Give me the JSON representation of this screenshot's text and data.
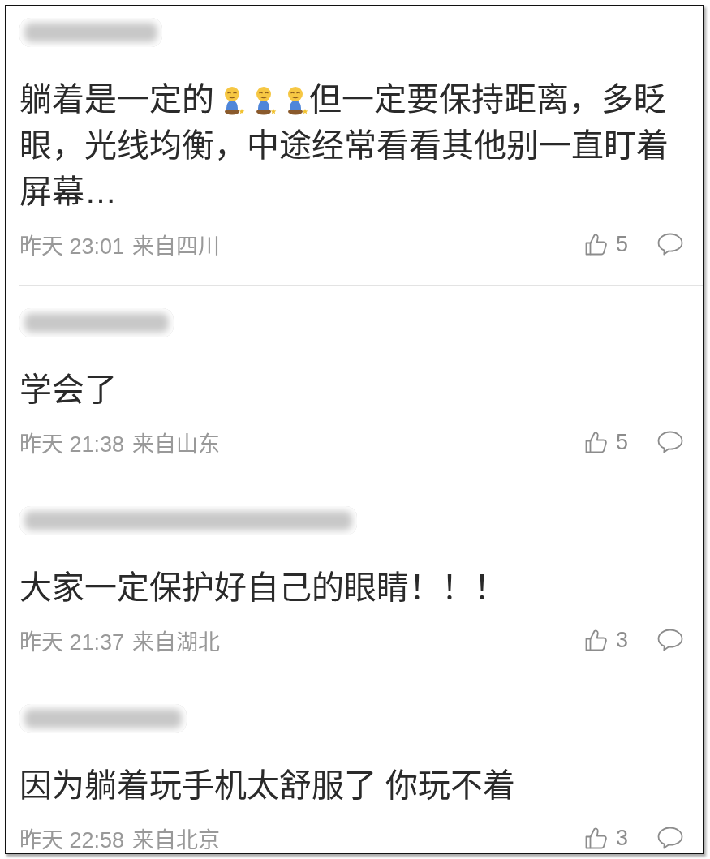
{
  "comments": [
    {
      "content": [
        {
          "kind": "text",
          "text": "躺着是一定的"
        },
        {
          "kind": "emoji"
        },
        {
          "kind": "emoji"
        },
        {
          "kind": "emoji"
        },
        {
          "kind": "text",
          "text": "但一定要保持距离，多眨"
        },
        {
          "kind": "text",
          "text": "眼，光线均衡，中途经常看看其他别一直盯着屏幕…"
        }
      ],
      "time": "昨天 23:01",
      "location": "来自四川",
      "likes": "5"
    },
    {
      "content": [
        {
          "kind": "text",
          "text": "学会了"
        }
      ],
      "time": "昨天 21:38",
      "location": "来自山东",
      "likes": "5"
    },
    {
      "content": [
        {
          "kind": "text",
          "text": "大家一定保护好自己的眼睛！！！"
        }
      ],
      "time": "昨天 21:37",
      "location": "来自湖北",
      "likes": "3"
    },
    {
      "content": [
        {
          "kind": "text",
          "text": "因为躺着玩手机太舒服了 你玩不着"
        }
      ],
      "time": "昨天 22:58",
      "location": "来自北京",
      "likes": "3"
    }
  ]
}
